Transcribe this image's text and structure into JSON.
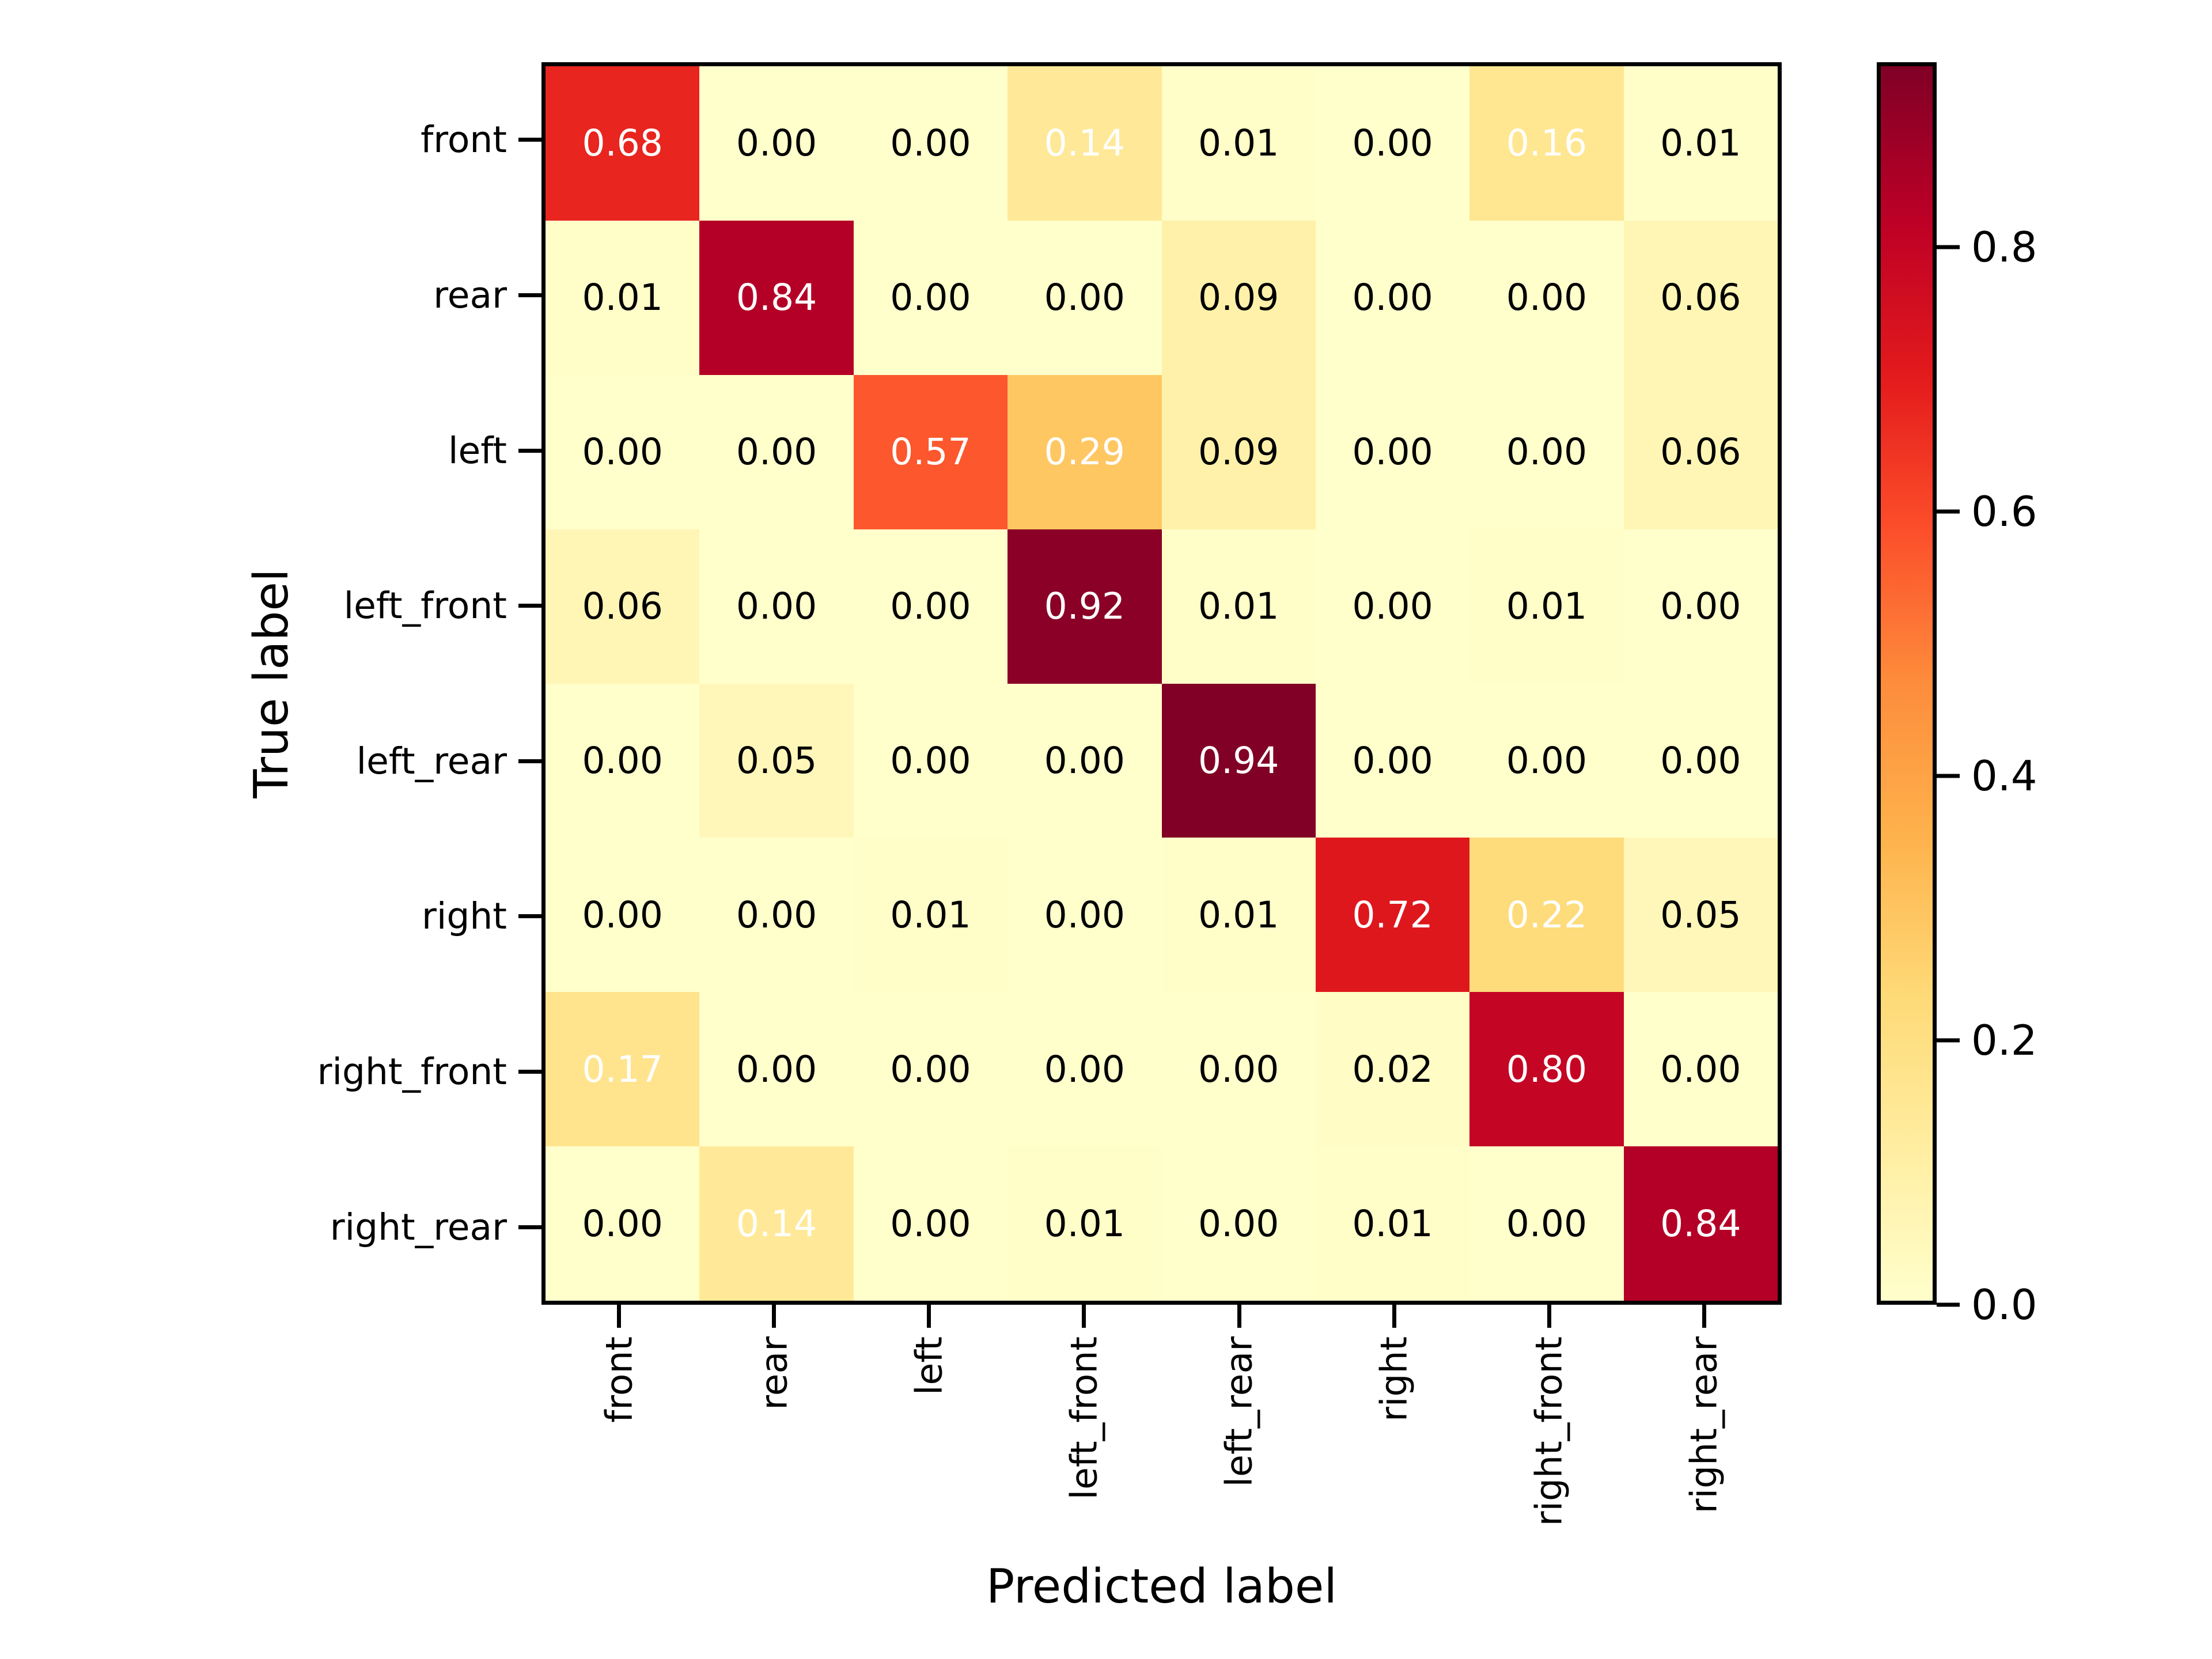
{
  "chart_data": {
    "type": "heatmap",
    "title": "",
    "xlabel": "Predicted label",
    "ylabel": "True label",
    "categories": [
      "front",
      "rear",
      "left",
      "left_front",
      "left_rear",
      "right",
      "right_front",
      "right_rear"
    ],
    "x_tick_labels": [
      "front",
      "rear",
      "left",
      "left_front",
      "left_rear",
      "right",
      "right_front",
      "right_rear"
    ],
    "y_tick_labels": [
      "front",
      "rear",
      "left",
      "left_front",
      "left_rear",
      "right",
      "right_front",
      "right_rear"
    ],
    "colormap": "YlOrRd",
    "colorbar": {
      "ticks": [
        0.0,
        0.2,
        0.4,
        0.6,
        0.8
      ],
      "tick_labels": [
        "0.0",
        "0.2",
        "0.4",
        "0.6",
        "0.8"
      ],
      "vmin": 0.0,
      "vmax": 0.94,
      "position": "right"
    },
    "grid": false,
    "legend": null,
    "annotations_format": "0.00",
    "rows": [
      {
        "label": "front",
        "values": [
          0.68,
          0.0,
          0.0,
          0.14,
          0.01,
          0.0,
          0.16,
          0.01
        ]
      },
      {
        "label": "rear",
        "values": [
          0.01,
          0.84,
          0.0,
          0.0,
          0.09,
          0.0,
          0.0,
          0.06
        ]
      },
      {
        "label": "left",
        "values": [
          0.0,
          0.0,
          0.57,
          0.29,
          0.09,
          0.0,
          0.0,
          0.06
        ]
      },
      {
        "label": "left_front",
        "values": [
          0.06,
          0.0,
          0.0,
          0.92,
          0.01,
          0.0,
          0.01,
          0.0
        ]
      },
      {
        "label": "left_rear",
        "values": [
          0.0,
          0.05,
          0.0,
          0.0,
          0.94,
          0.0,
          0.0,
          0.0
        ]
      },
      {
        "label": "right",
        "values": [
          0.0,
          0.0,
          0.01,
          0.0,
          0.01,
          0.72,
          0.22,
          0.05
        ]
      },
      {
        "label": "right_front",
        "values": [
          0.17,
          0.0,
          0.0,
          0.0,
          0.0,
          0.02,
          0.8,
          0.0
        ]
      },
      {
        "label": "right_rear",
        "values": [
          0.0,
          0.14,
          0.0,
          0.01,
          0.0,
          0.01,
          0.0,
          0.84
        ]
      }
    ],
    "cell_text": [
      [
        "0.68",
        "0.00",
        "0.00",
        "0.14",
        "0.01",
        "0.00",
        "0.16",
        "0.01"
      ],
      [
        "0.01",
        "0.84",
        "0.00",
        "0.00",
        "0.09",
        "0.00",
        "0.00",
        "0.06"
      ],
      [
        "0.00",
        "0.00",
        "0.57",
        "0.29",
        "0.09",
        "0.00",
        "0.00",
        "0.06"
      ],
      [
        "0.06",
        "0.00",
        "0.00",
        "0.92",
        "0.01",
        "0.00",
        "0.01",
        "0.00"
      ],
      [
        "0.00",
        "0.05",
        "0.00",
        "0.00",
        "0.94",
        "0.00",
        "0.00",
        "0.00"
      ],
      [
        "0.00",
        "0.00",
        "0.01",
        "0.00",
        "0.01",
        "0.72",
        "0.22",
        "0.05"
      ],
      [
        "0.17",
        "0.00",
        "0.00",
        "0.00",
        "0.00",
        "0.02",
        "0.80",
        "0.00"
      ],
      [
        "0.00",
        "0.14",
        "0.00",
        "0.01",
        "0.00",
        "0.01",
        "0.00",
        "0.84"
      ]
    ],
    "cell_text_colors": [
      [
        "light",
        "dark",
        "dark",
        "light",
        "dark",
        "dark",
        "light",
        "dark"
      ],
      [
        "dark",
        "light",
        "dark",
        "dark",
        "dark",
        "dark",
        "dark",
        "dark"
      ],
      [
        "dark",
        "dark",
        "light",
        "light",
        "dark",
        "dark",
        "dark",
        "dark"
      ],
      [
        "dark",
        "dark",
        "dark",
        "light",
        "dark",
        "dark",
        "dark",
        "dark"
      ],
      [
        "dark",
        "dark",
        "dark",
        "dark",
        "light",
        "dark",
        "dark",
        "dark"
      ],
      [
        "dark",
        "dark",
        "dark",
        "dark",
        "dark",
        "light",
        "light",
        "dark"
      ],
      [
        "light",
        "dark",
        "dark",
        "dark",
        "dark",
        "dark",
        "light",
        "dark"
      ],
      [
        "dark",
        "light",
        "dark",
        "dark",
        "dark",
        "dark",
        "dark",
        "light"
      ]
    ]
  },
  "colors": {
    "axis": "#000000",
    "text": "#000000",
    "text_light": "#ffffff",
    "background": "#ffffff",
    "cmap_stops": [
      "#ffffcc",
      "#ffeda0",
      "#fed976",
      "#feb24c",
      "#fd8d3c",
      "#fc4e2a",
      "#e31a1c",
      "#bd0026",
      "#800026"
    ]
  }
}
